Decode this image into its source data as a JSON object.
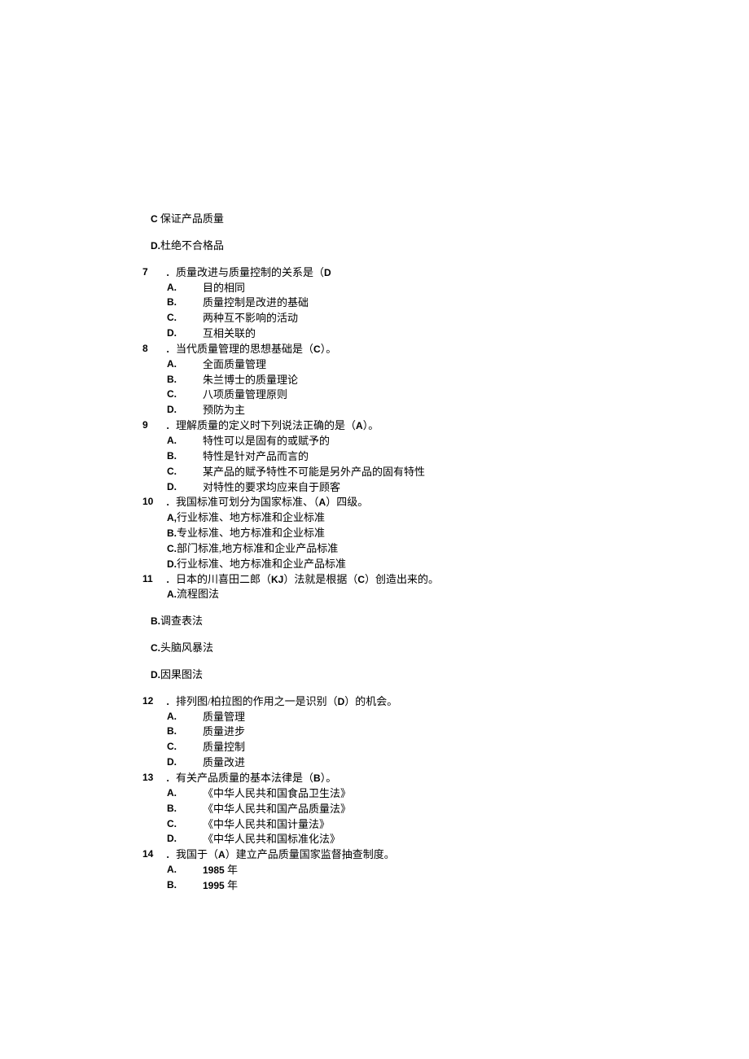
{
  "orphan": {
    "c_letter": "C",
    "c_text": " 保证产品质量",
    "d_letter": "D.",
    "d_text": "杜绝不合格品"
  },
  "q7": {
    "num": "7",
    "text": "．质量改进与质量控制的关系是（",
    "ans": "D",
    "opts": [
      {
        "l": "A.",
        "t": "目的相同"
      },
      {
        "l": "B.",
        "t": "质量控制是改进的基础"
      },
      {
        "l": "C.",
        "t": "两种互不影响的活动"
      },
      {
        "l": "D.",
        "t": "互相关联的"
      }
    ]
  },
  "q8": {
    "num": "8",
    "text": "．当代质量管理的思想基础是（",
    "ans": "C",
    "tail": "）。",
    "opts": [
      {
        "l": "A.",
        "t": "全面质量管理"
      },
      {
        "l": "B.",
        "t": "朱兰博士的质量理论"
      },
      {
        "l": "C.",
        "t": "八项质量管理原则"
      },
      {
        "l": "D.",
        "t": "预防为主"
      }
    ]
  },
  "q9": {
    "num": "9",
    "text": "．理解质量的定义时下列说法正确的是（",
    "ans": "A",
    "tail": "）。",
    "opts": [
      {
        "l": "A.",
        "t": "特性可以是固有的或赋予的"
      },
      {
        "l": "B.",
        "t": "特性是针对产品而言的"
      },
      {
        "l": "C.",
        "t": "某产品的赋予特性不可能是另外产品的固有特性"
      },
      {
        "l": "D.",
        "t": "对特性的要求均应来自于顾客"
      }
    ]
  },
  "q10": {
    "num": "10",
    "text": "．我国标准可划分为国家标准、（",
    "ans": "A",
    "tail": "）四级。",
    "opts": [
      {
        "l": "A,",
        "t": "行业标准、地方标准和企业标准"
      },
      {
        "l": "B.",
        "t": "专业标准、地方标准和企业标准"
      },
      {
        "l": "C.",
        "t": "部门标准,地方标准和企业产品标准"
      },
      {
        "l": "D.",
        "t": "行业标准、地方标准和企业产品标准"
      }
    ]
  },
  "q11": {
    "num": "11",
    "text1": "．日本的川喜田二郎（",
    "kj": "KJ",
    "text2": "）法就是根据（",
    "ans": "C",
    "tail": "）创造出来的。",
    "opts": [
      {
        "l": "A.",
        "t": "流程图法"
      },
      {
        "l": "B.",
        "t": "调查表法"
      },
      {
        "l": "C.",
        "t": "头脑风暴法"
      },
      {
        "l": "D.",
        "t": "因果图法"
      }
    ]
  },
  "q12": {
    "num": "12",
    "text": "．排列图/柏拉图的作用之一是识别（",
    "ans": "D",
    "tail": "）的机会。",
    "opts": [
      {
        "l": "A.",
        "t": "质量管理"
      },
      {
        "l": "B.",
        "t": "质量进步"
      },
      {
        "l": "C.",
        "t": "质量控制"
      },
      {
        "l": "D.",
        "t": "质量改进"
      }
    ]
  },
  "q13": {
    "num": "13",
    "text": "．有关产品质量的基本法律是（",
    "ans": "B",
    "tail": "）。",
    "opts": [
      {
        "l": "A.",
        "t": "《中华人民共和国食品卫生法》"
      },
      {
        "l": "B.",
        "t": "《中华人民共和国产品质量法》"
      },
      {
        "l": "C.",
        "t": "《中华人民共和国计量法》"
      },
      {
        "l": "D.",
        "t": "《中华人民共和国标准化法》"
      }
    ]
  },
  "q14": {
    "num": "14",
    "text": "．我国于（",
    "ans": "A",
    "tail": "）建立产品质量国家监督抽查制度。",
    "opts": [
      {
        "l": "A.",
        "y": "1985",
        "t": " 年"
      },
      {
        "l": "B.",
        "y": "1995",
        "t": " 年"
      }
    ]
  }
}
